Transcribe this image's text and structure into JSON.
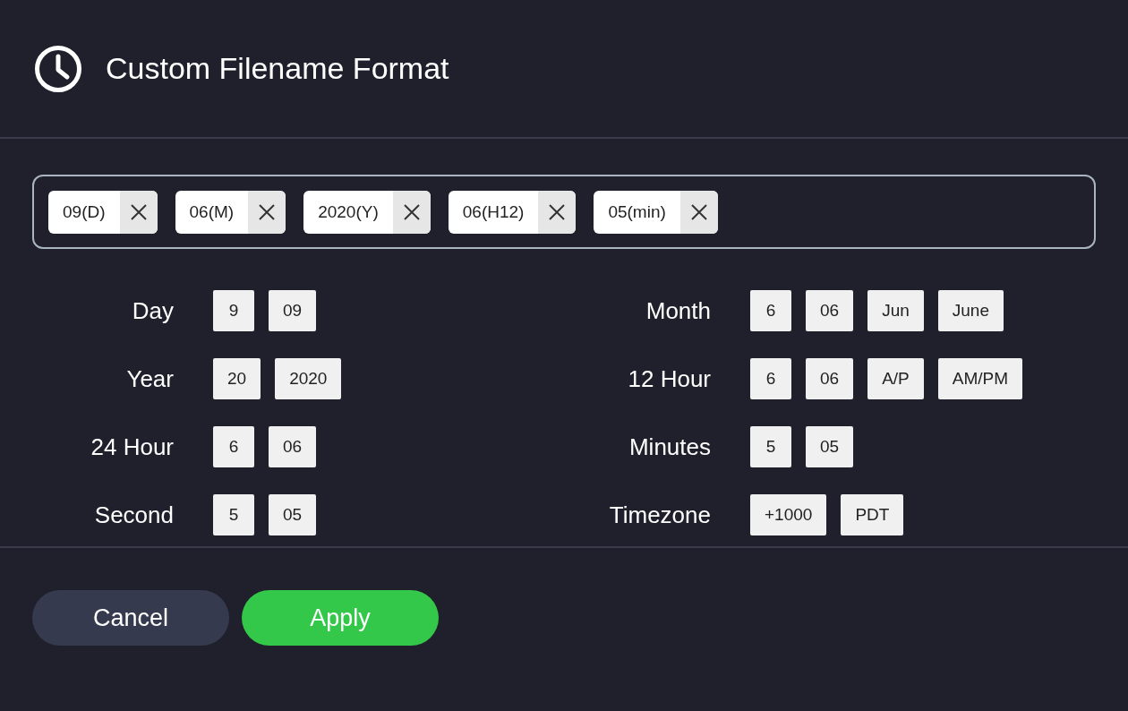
{
  "title": "Custom Filename Format",
  "tokens": [
    {
      "label": "09(D)"
    },
    {
      "label": "06(M)"
    },
    {
      "label": "2020(Y)"
    },
    {
      "label": "06(H12)"
    },
    {
      "label": "05(min)"
    }
  ],
  "columns": [
    [
      {
        "label": "Day",
        "options": [
          "9",
          "09"
        ]
      },
      {
        "label": "Year",
        "options": [
          "20",
          "2020"
        ]
      },
      {
        "label": "24 Hour",
        "options": [
          "6",
          "06"
        ]
      },
      {
        "label": "Second",
        "options": [
          "5",
          "05"
        ]
      }
    ],
    [
      {
        "label": "Month",
        "options": [
          "6",
          "06",
          "Jun",
          "June"
        ]
      },
      {
        "label": "12 Hour",
        "options": [
          "6",
          "06",
          "A/P",
          "AM/PM"
        ]
      },
      {
        "label": "Minutes",
        "options": [
          "5",
          "05"
        ]
      },
      {
        "label": "Timezone",
        "options": [
          "+1000",
          "PDT"
        ]
      }
    ]
  ],
  "buttons": [
    {
      "label": "Cancel",
      "kind": "secondary"
    },
    {
      "label": "Apply",
      "kind": "primary"
    }
  ]
}
